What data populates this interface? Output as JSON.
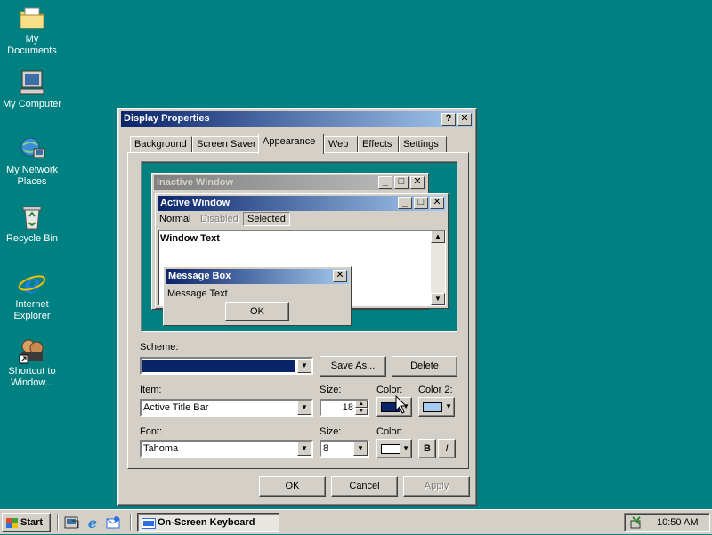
{
  "desktop": {
    "icons": [
      {
        "label": "My Documents",
        "icon": "folder-documents-icon"
      },
      {
        "label": "My Computer",
        "icon": "computer-icon"
      },
      {
        "label": "My Network Places",
        "icon": "network-places-icon"
      },
      {
        "label": "Recycle Bin",
        "icon": "recycle-bin-icon"
      },
      {
        "label": "Internet Explorer",
        "icon": "internet-explorer-icon"
      },
      {
        "label": "Shortcut to Window...",
        "icon": "shortcut-icon"
      }
    ]
  },
  "dialog": {
    "title": "Display Properties",
    "help_btn": "?",
    "close_btn": "✕",
    "tabs": [
      "Background",
      "Screen Saver",
      "Appearance",
      "Web",
      "Effects",
      "Settings"
    ],
    "active_tab": "Appearance",
    "preview": {
      "inactive_title": "Inactive Window",
      "active_title": "Active Window",
      "menu_items": [
        "Normal",
        "Disabled",
        "Selected"
      ],
      "window_text": "Window Text",
      "msgbox_title": "Message Box",
      "msgbox_text": "Message Text",
      "msgbox_ok": "OK"
    },
    "scheme": {
      "label": "Scheme:",
      "value": "",
      "save_as": "Save As...",
      "delete": "Delete"
    },
    "item": {
      "label": "Item:",
      "value": "Active Title Bar",
      "size_label": "Size:",
      "size_value": "18",
      "color_label": "Color:",
      "color_value": "#0a246a",
      "color2_label": "Color 2:",
      "color2_value": "#a6caf0"
    },
    "font": {
      "label": "Font:",
      "value": "Tahoma",
      "size_label": "Size:",
      "size_value": "8",
      "color_label": "Color:",
      "color_value": "#ffffff",
      "bold": "B",
      "italic": "I"
    },
    "buttons": {
      "ok": "OK",
      "cancel": "Cancel",
      "apply": "Apply"
    }
  },
  "taskbar": {
    "start": "Start",
    "quick_launch": [
      "show-desktop-icon",
      "internet-explorer-icon",
      "outlook-express-icon"
    ],
    "task": "On-Screen Keyboard",
    "clock": "10:50 AM"
  },
  "colors": {
    "desktop": "#008080",
    "title_start": "#0a246a",
    "title_end": "#a6caf0",
    "face": "#d4d0c8"
  }
}
